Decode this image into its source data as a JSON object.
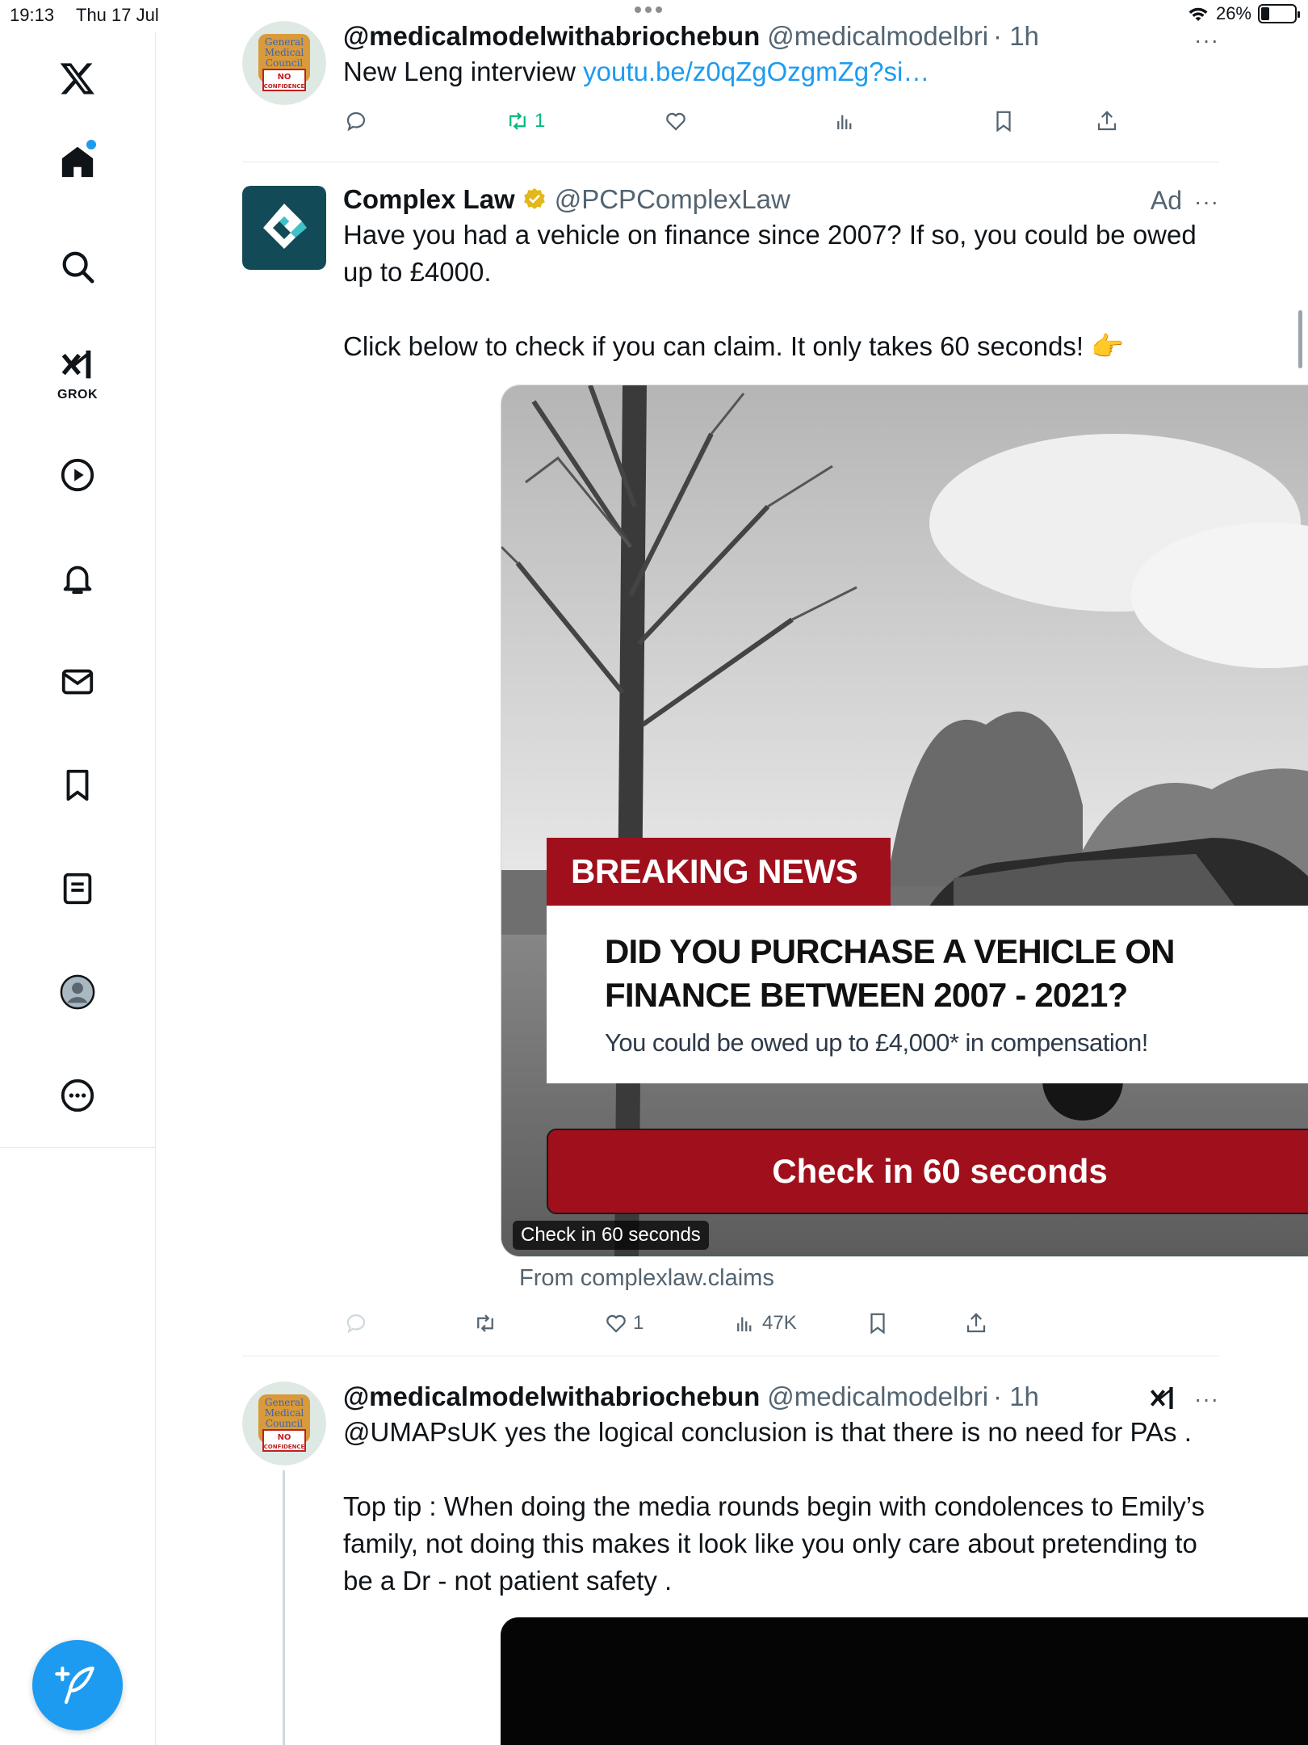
{
  "status_bar": {
    "time": "19:13",
    "date": "Thu 17 Jul",
    "battery_percent": "26%",
    "battery_level": 0.26
  },
  "sidebar": {
    "grok_label": "GROK",
    "items": [
      {
        "name": "x-logo-icon"
      },
      {
        "name": "home-icon"
      },
      {
        "name": "search-icon"
      },
      {
        "name": "grok-icon"
      },
      {
        "name": "video-icon"
      },
      {
        "name": "notifications-icon"
      },
      {
        "name": "messages-icon"
      },
      {
        "name": "bookmarks-icon"
      },
      {
        "name": "lists-icon"
      },
      {
        "name": "profile-icon"
      },
      {
        "name": "more-icon"
      }
    ],
    "compose_icon": "compose-icon"
  },
  "tweets": [
    {
      "display_name": "@medicalmodelwithabriochebun",
      "handle": "@medicalmodelbri",
      "time": "· 1h",
      "text_prefix": "New Leng interview ",
      "link_text": "youtu.be/z0qZgOzgmZg?si…",
      "retweet_count": "1",
      "more": "···"
    },
    {
      "display_name": "Complex Law",
      "handle": "@PCPComplexLaw",
      "ad_label": "Ad",
      "more": "···",
      "text_line1": "Have you had a vehicle on finance since 2007? If so, you could be owed up to £4000.",
      "text_line2": "Click below to check if you can claim. It only takes 60 seconds! 👉",
      "media": {
        "breaking": "BREAKING NEWS",
        "headline": "DID YOU PURCHASE A VEHICLE ON FINANCE BETWEEN 2007 - 2021?",
        "subline": "You could be owed up to £4,000* in compensation!",
        "cta": "Check in 60 seconds",
        "cta_chip": "Check in 60 seconds"
      },
      "from": "From complexlaw.claims",
      "like_count": "1",
      "view_count": "47K"
    },
    {
      "display_name": "@medicalmodelwithabriochebun",
      "handle": "@medicalmodelbri",
      "time": "· 1h",
      "more": "···",
      "text_line1": "@UMAPsUK yes the logical conclusion is that there is no need for PAs .",
      "text_line2": "Top tip : When doing the media rounds begin with condolences to Emily’s family, not doing this makes it look like you only care about pretending to be a Dr - not patient safety  ."
    }
  ],
  "avatar_text": {
    "line1": "General",
    "line2": "Medical",
    "line3": "Council",
    "line4": "NO",
    "line5": "CONFIDENCE"
  },
  "colors": {
    "accent": "#1d9bf0",
    "retweet_green": "#00ba7c",
    "ad_red": "#a0101c",
    "verified_gold": "#e2b719",
    "complexlaw_teal": "#124a57"
  }
}
